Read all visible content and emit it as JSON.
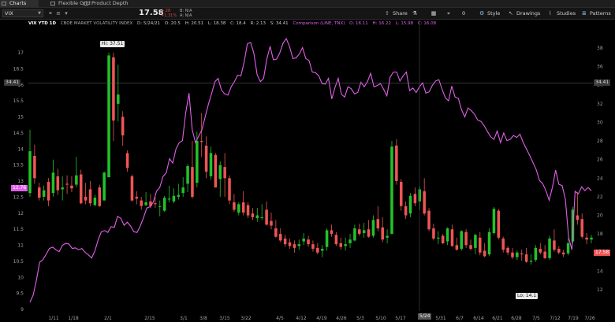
{
  "tabs": [
    {
      "label": "Charts",
      "active": true
    },
    {
      "label": "Flexible Grid",
      "active": false
    },
    {
      "label": "Product Depth",
      "active": false
    }
  ],
  "toolbar": {
    "symbol": "VIX",
    "last": "17.58",
    "change": "+.28",
    "change_pct": "+1.31%",
    "bid": "B: N/A",
    "ask": "A: N/A",
    "share": "Share",
    "zero": "0",
    "style": "Style",
    "drawings": "Drawings",
    "studies": "Studies",
    "patterns": "Patterns"
  },
  "study_line": {
    "name": "VIX YTD 1D",
    "desc": "CBOE MARKET VOLATILITY INDEX",
    "date": "D: 5/24/21",
    "open": "O: 20.5",
    "high": "H: 20.51",
    "low": "L: 18.38",
    "close": "C: 18.4",
    "range": "R: 2.13",
    "val": "S: 34.41",
    "comparison": "Comparison (LINE, TNX)",
    "cmp_open": "O: 16.11",
    "cmp_high": "H: 16.22",
    "cmp_low": "L: 15.98",
    "cmp_close": "C: 16.08"
  },
  "price_labels": {
    "crosshair_left": "34.41",
    "crosshair_right": "34.41",
    "last_left": "12.76",
    "last_right": "17.58",
    "hi_bubble": "Hi: 37.51",
    "lo_bubble": "Lo: 14.1",
    "cursor_date": "5/24"
  },
  "axes": {
    "left_ticks": [
      "17",
      "16.5",
      "16",
      "15.5",
      "15",
      "14.5",
      "14",
      "13.5",
      "13",
      "12.5",
      "12",
      "11.5",
      "11",
      "10.5",
      "10",
      "9.5",
      "9"
    ],
    "right_ticks": [
      "38",
      "36",
      "34",
      "32",
      "30",
      "28",
      "26",
      "24",
      "22",
      "20",
      "18",
      "16",
      "14",
      "12"
    ],
    "x_ticks": [
      "1/11",
      "1/18",
      "2/1",
      "2/15",
      "3/1",
      "3/8",
      "3/15",
      "3/22",
      "4/5",
      "4/12",
      "4/19",
      "4/26",
      "5/3",
      "5/10",
      "5/17",
      "5/31",
      "6/7",
      "6/14",
      "6/21",
      "6/28",
      "7/5",
      "7/12",
      "7/19",
      "7/26"
    ]
  },
  "colors": {
    "up": "#22c22a",
    "down": "#ee5555",
    "comparison": "#e060e8",
    "background": "#000000",
    "grid": "#1c1c1c"
  },
  "chart_data": {
    "type": "candlestick",
    "title": "VIX YTD 1D",
    "ylim_right": [
      12,
      40
    ],
    "ylim_left": [
      9,
      17.6
    ],
    "x_range": [
      "1/4",
      "7/28"
    ],
    "series": [
      {
        "name": "VIX",
        "axis": "right",
        "ohlc": [
          [
            22.4,
            29.2,
            22.0,
            26.9
          ],
          [
            26.4,
            27.6,
            23.4,
            24.0
          ],
          [
            23.0,
            23.5,
            21.6,
            21.9
          ],
          [
            22.0,
            23.2,
            21.6,
            22.7
          ],
          [
            23.6,
            24.0,
            21.0,
            21.6
          ],
          [
            22.4,
            26.0,
            22.0,
            24.6
          ],
          [
            24.2,
            25.0,
            22.2,
            22.7
          ],
          [
            22.8,
            24.2,
            21.6,
            23.0
          ],
          [
            23.4,
            24.3,
            22.3,
            23.3
          ],
          [
            23.2,
            24.2,
            22.5,
            22.9
          ],
          [
            23.3,
            26.3,
            23.0,
            24.3
          ],
          [
            24.4,
            24.9,
            21.2,
            21.3
          ],
          [
            22.0,
            23.5,
            21.2,
            21.6
          ],
          [
            22.8,
            23.7,
            21.0,
            21.3
          ],
          [
            21.1,
            22.2,
            21.0,
            21.9
          ],
          [
            23.0,
            23.3,
            20.9,
            21.0
          ],
          [
            21.6,
            24.7,
            21.6,
            24.6
          ],
          [
            24.1,
            37.5,
            24.1,
            37.2
          ],
          [
            37.0,
            37.5,
            28.0,
            30.2
          ],
          [
            32.0,
            36.2,
            30.1,
            33.0
          ],
          [
            30.6,
            31.2,
            27.5,
            28.6
          ],
          [
            26.7,
            27.0,
            24.7,
            25.1
          ],
          [
            24.2,
            24.4,
            21.5,
            21.6
          ],
          [
            22.0,
            22.6,
            21.2,
            21.8
          ],
          [
            21.6,
            22.0,
            20.6,
            21.0
          ],
          [
            21.1,
            22.5,
            21.0,
            21.4
          ],
          [
            21.5,
            22.3,
            20.8,
            21.0
          ],
          [
            21.3,
            22.0,
            20.8,
            21.2
          ],
          [
            21.0,
            21.6,
            19.9,
            21.0
          ],
          [
            20.5,
            22.1,
            20.4,
            21.9
          ],
          [
            21.7,
            23.2,
            21.4,
            21.8
          ],
          [
            21.5,
            22.9,
            21.3,
            22.1
          ],
          [
            22.0,
            23.4,
            21.7,
            22.2
          ],
          [
            22.4,
            24.1,
            22.0,
            23.0
          ],
          [
            23.4,
            25.5,
            22.5,
            25.3
          ],
          [
            25.2,
            28.0,
            21.8,
            22.0
          ],
          [
            23.5,
            29.0,
            23.0,
            28.0
          ],
          [
            28.0,
            31.0,
            26.3,
            27.9
          ],
          [
            27.5,
            28.5,
            24.0,
            24.7
          ],
          [
            24.2,
            27.4,
            23.8,
            26.7
          ],
          [
            26.5,
            26.7,
            23.0,
            23.0
          ],
          [
            23.9,
            25.8,
            22.0,
            25.4
          ],
          [
            25.2,
            26.7,
            22.0,
            24.0
          ],
          [
            24.0,
            24.3,
            21.2,
            21.6
          ],
          [
            21.4,
            22.3,
            20.4,
            20.6
          ],
          [
            20.3,
            21.4,
            20.0,
            21.2
          ],
          [
            21.4,
            22.6,
            20.0,
            20.3
          ],
          [
            21.1,
            21.4,
            19.7,
            20.0
          ],
          [
            20.2,
            20.8,
            19.5,
            19.8
          ],
          [
            19.7,
            20.8,
            19.3,
            20.0
          ],
          [
            19.8,
            21.2,
            19.5,
            19.8
          ],
          [
            20.6,
            21.5,
            18.9,
            19.0
          ],
          [
            19.4,
            20.3,
            18.5,
            18.9
          ],
          [
            18.6,
            19.5,
            17.6,
            17.7
          ],
          [
            18.0,
            18.6,
            17.1,
            17.3
          ],
          [
            17.5,
            17.9,
            16.6,
            16.9
          ],
          [
            17.1,
            17.5,
            16.4,
            16.7
          ],
          [
            16.9,
            17.3,
            16.0,
            16.5
          ],
          [
            16.7,
            17.4,
            16.3,
            16.9
          ],
          [
            17.2,
            18.1,
            16.8,
            17.5
          ],
          [
            17.4,
            17.8,
            16.6,
            16.9
          ],
          [
            16.9,
            17.3,
            16.1,
            16.4
          ],
          [
            16.5,
            17.0,
            15.8,
            16.0
          ],
          [
            16.2,
            16.8,
            15.5,
            16.4
          ],
          [
            16.6,
            18.6,
            16.2,
            18.4
          ],
          [
            18.4,
            19.0,
            17.7,
            18.0
          ],
          [
            17.9,
            18.2,
            16.7,
            16.9
          ],
          [
            17.0,
            17.6,
            16.3,
            16.6
          ],
          [
            16.7,
            17.6,
            16.2,
            16.9
          ],
          [
            17.0,
            18.0,
            16.5,
            17.4
          ],
          [
            17.3,
            19.0,
            17.2,
            18.6
          ],
          [
            18.5,
            19.1,
            17.8,
            18.0
          ],
          [
            18.1,
            19.2,
            17.6,
            18.4
          ],
          [
            18.5,
            19.5,
            17.6,
            17.7
          ],
          [
            17.8,
            20.0,
            17.6,
            19.5
          ],
          [
            19.6,
            21.0,
            18.3,
            18.6
          ],
          [
            18.7,
            19.8,
            17.1,
            17.4
          ],
          [
            17.6,
            18.5,
            17.0,
            17.8
          ],
          [
            18.0,
            28.0,
            18.0,
            27.4
          ],
          [
            27.5,
            28.2,
            23.3,
            23.7
          ],
          [
            23.6,
            23.9,
            20.5,
            21.0
          ],
          [
            21.0,
            21.5,
            19.6,
            20.0
          ],
          [
            20.2,
            22.4,
            19.8,
            22.1
          ],
          [
            22.3,
            23.0,
            21.0,
            21.3
          ],
          [
            21.5,
            23.1,
            20.6,
            22.8
          ],
          [
            22.6,
            24.0,
            20.0,
            20.2
          ],
          [
            20.5,
            20.8,
            18.3,
            18.5
          ],
          [
            18.6,
            19.1,
            17.3,
            17.5
          ],
          [
            17.5,
            18.3,
            16.9,
            17.6
          ],
          [
            17.8,
            18.0,
            16.9,
            17.0
          ],
          [
            17.2,
            18.7,
            16.8,
            18.6
          ],
          [
            18.5,
            19.0,
            16.6,
            16.7
          ],
          [
            16.8,
            17.6,
            16.2,
            16.3
          ],
          [
            16.4,
            18.4,
            16.2,
            18.3
          ],
          [
            18.2,
            18.5,
            16.5,
            16.8
          ],
          [
            16.8,
            17.4,
            16.2,
            16.4
          ],
          [
            16.5,
            18.0,
            15.8,
            17.9
          ],
          [
            17.6,
            18.2,
            15.7,
            16.0
          ],
          [
            16.2,
            17.0,
            15.5,
            15.6
          ],
          [
            15.8,
            18.6,
            15.6,
            18.2
          ],
          [
            18.1,
            20.9,
            17.9,
            20.7
          ],
          [
            20.5,
            20.7,
            17.4,
            17.6
          ],
          [
            17.5,
            17.7,
            16.0,
            16.3
          ],
          [
            16.5,
            16.7,
            15.7,
            16.0
          ],
          [
            16.0,
            16.5,
            15.3,
            15.5
          ],
          [
            15.5,
            16.2,
            15.2,
            16.0
          ],
          [
            15.9,
            16.3,
            15.1,
            15.8
          ],
          [
            15.8,
            16.5,
            14.9,
            15.0
          ],
          [
            15.0,
            15.8,
            14.7,
            15.1
          ],
          [
            15.2,
            16.8,
            15.0,
            16.5
          ],
          [
            16.4,
            17.0,
            15.8,
            16.0
          ],
          [
            16.1,
            16.8,
            15.3,
            15.4
          ],
          [
            15.4,
            17.8,
            15.2,
            17.5
          ],
          [
            17.3,
            18.5,
            16.1,
            16.3
          ],
          [
            16.4,
            16.7,
            15.8,
            16.0
          ],
          [
            16.0,
            16.3,
            15.5,
            15.8
          ],
          [
            15.9,
            17.5,
            15.7,
            17.0
          ],
          [
            17.2,
            20.9,
            17.0,
            20.6
          ],
          [
            20.0,
            22.5,
            19.0,
            19.5
          ],
          [
            19.6,
            20.2,
            17.5,
            17.7
          ],
          [
            17.6,
            18.1,
            16.9,
            17.4
          ],
          [
            17.4,
            17.9,
            17.0,
            17.6
          ]
        ]
      },
      {
        "name": "TNX",
        "axis": "left",
        "closes": [
          9.22,
          9.45,
          9.91,
          10.47,
          10.55,
          10.72,
          10.9,
          10.94,
          10.86,
          10.8,
          11.0,
          11.06,
          11.04,
          10.9,
          10.92,
          10.86,
          10.9,
          10.78,
          10.7,
          10.6,
          10.82,
          11.16,
          11.42,
          11.46,
          11.4,
          11.58,
          11.56,
          11.9,
          11.84,
          11.62,
          11.72,
          11.6,
          11.42,
          11.4,
          11.6,
          11.86,
          12.16,
          12.2,
          12.34,
          12.68,
          12.8,
          13.14,
          13.26,
          13.7,
          13.56,
          14.0,
          14.2,
          14.26,
          15.12,
          15.74,
          14.6,
          14.2,
          14.4,
          14.6,
          15.0,
          15.4,
          15.74,
          16.1,
          16.2,
          15.84,
          15.72,
          15.68,
          15.94,
          16.1,
          16.3,
          16.28,
          16.7,
          17.28,
          17.32,
          16.98,
          16.32,
          16.1,
          16.2,
          16.8,
          17.2,
          16.78,
          16.8,
          17.0,
          17.3,
          17.44,
          17.2,
          16.82,
          16.84,
          16.96,
          17.16,
          16.82,
          16.76,
          16.4,
          16.38,
          16.28,
          16.04,
          16.02,
          16.2,
          15.56,
          15.92,
          16.2,
          15.7,
          15.62,
          15.94,
          15.88,
          15.72,
          15.76,
          16.08,
          15.94,
          16.1,
          16.36,
          15.94,
          15.98,
          16.04,
          15.86,
          15.66,
          16.24,
          16.4,
          16.4,
          16.12,
          16.28,
          16.4,
          15.82,
          15.9,
          15.76,
          15.94,
          16.06,
          15.74,
          15.78,
          15.98,
          16.12,
          16.16,
          15.86,
          15.6,
          15.5,
          15.96,
          15.62,
          15.58,
          15.22,
          15.0,
          15.28,
          15.2,
          15.08,
          14.9,
          14.86,
          14.72,
          14.54,
          14.38,
          14.3,
          14.56,
          14.2,
          14.5,
          14.26,
          14.3,
          14.42,
          14.36,
          14.46,
          14.2,
          14.0,
          13.8,
          13.58,
          13.36,
          13.02,
          12.92,
          12.7,
          12.4,
          12.8,
          13.34,
          12.9,
          12.86,
          12.42,
          11.24,
          10.86,
          12.68,
          12.6,
          12.82,
          12.7,
          12.8,
          12.7
        ]
      }
    ]
  }
}
